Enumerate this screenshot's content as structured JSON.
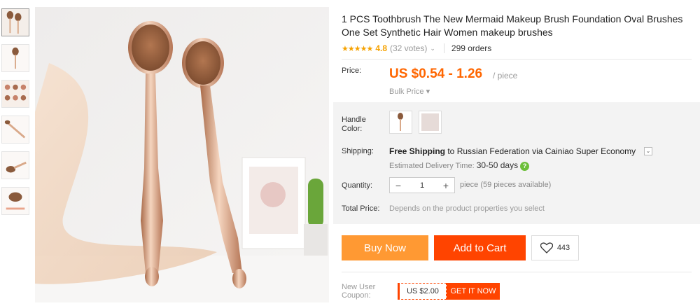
{
  "product": {
    "title": "1 PCS Toothbrush The New Mermaid Makeup Brush Foundation Oval Brushes One Set Synthetic Hair Women makeup brushes",
    "stars": "★★★★★",
    "rating": "4.8",
    "votes": "(32 votes)",
    "orders": "299 orders"
  },
  "price": {
    "label": "Price:",
    "value": "US $0.54 - 1.26",
    "unit": "/ piece",
    "bulk": "Bulk Price ▾"
  },
  "handle_color": {
    "label": "Handle Color:",
    "options": [
      "brush-image",
      "#e6dbd8"
    ]
  },
  "shipping": {
    "label": "Shipping:",
    "free": "Free Shipping",
    "rest": " to Russian Federation via Cainiao Super Economy",
    "estimated_label": "Estimated Delivery Time: ",
    "days": "30-50 days",
    "help_icon": "?"
  },
  "quantity": {
    "label": "Quantity:",
    "value": "1",
    "minus": "−",
    "plus": "+",
    "available": "piece (59 pieces available)"
  },
  "total": {
    "label": "Total Price:",
    "text": "Depends on the product properties you select"
  },
  "actions": {
    "buy_now": "Buy Now",
    "add_to_cart": "Add to Cart",
    "wishlist_count": "443"
  },
  "coupon": {
    "label": "New User Coupon:",
    "amount": "US $2.00",
    "cta": "GET IT NOW"
  },
  "colors": {
    "price": "#ff6600",
    "buy_now": "#ff9933",
    "add_to_cart": "#ff4400",
    "star": "#f6a200",
    "rose_gold": "#d9a98a"
  }
}
